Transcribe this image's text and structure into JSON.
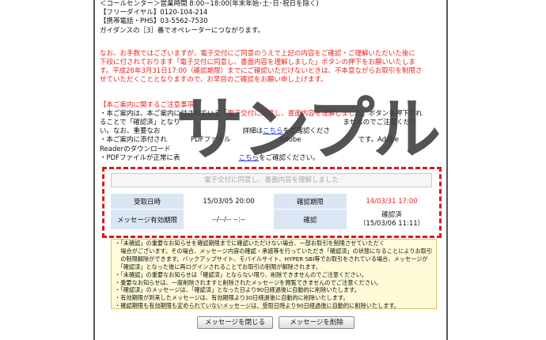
{
  "contact": {
    "line1": "＜コールセンター＞営業時間 8:00~18:00(年末年始･土･日･祝日を除く)",
    "line2": "【フリーダイヤル】0120-104-214",
    "line3": "【携帯電話・PHS】03-5562-7530",
    "line4": "ガイダンスの［3］番でオペレーターにつながります。"
  },
  "warning": {
    "line1": "なお、お手数ではございますが、電子交付にご同意のうえで上記の内容をご確認・ご理解いただいた後に",
    "line2": "下段に付されております「電子交付に同意し、書面内容を理解しました」ボタンの押下をお願いいたしま",
    "line3": "す。平成26年3月31日17:00（確認期限）までにご確認いただけないときは、不本意ながらお取引を制限さ",
    "line4": "せていただくこととなりますので、お早目のご確認をお願い申し上げます。"
  },
  "notes": {
    "heading": "【本ご案内に関するご注意事項】",
    "l1_a": "・本ご案内は、本ご案内に付されている「",
    "l1_hl": "電子交付に同意し、書面内容を理解しました",
    "l1_b": "」ボタンを押下され",
    "l2_a": "ることで「確認済」となり",
    "l2_b": "ませんのでご注意くださ",
    "l3_a": "い。なお、重要なお",
    "l3_b": "詳細は",
    "l3_link": "こちら",
    "l3_c": "をご確認くださ",
    "l4_a": "・本ご案内に添付され",
    "l4_b": "PDFファイル",
    "l4_c": "Adobe",
    "l4_d": "です。Adobe",
    "l5_a": "Readerのダウンロード",
    "l6_a": "・PDFファイルが正常に表",
    "l6_link": "こちら",
    "l6_b": "をご確認ください。"
  },
  "watermark": "サンプル",
  "agree_button": "電子交付に同意し、書面内容を理解しました",
  "info": {
    "received_label": "受取日時",
    "received_value": "15/03/05 20:00",
    "deadline_label": "確認期限",
    "deadline_value": "14/03/31 17:00",
    "expiry_label": "メッセージ有効期限",
    "expiry_value": "--/--/-- --:--",
    "confirm_label": "確認",
    "confirm_status": "確認済",
    "confirm_date": "（15/03/06 11:11）"
  },
  "notice_lines": [
    "・「未確認」の重要なお知らせを確認期限までに確認いただけない場合、一部お取引を制限させていただく",
    "　場合がございます。その場合、メッセージ内容の確認・承諾等を行っていただき「確認済」の状態になることによりお取引",
    "　の制限解除ができます。バックアップサイト、モバイルサイト、HYPER SBI等でお取引をされている場合、メッセージが",
    "　「確認済」となった後に再ログインされることでお取引の制限が解除されます。",
    "・「未確認」の重要なお知らせは「確認済」とならない限り、削除できませんのでご注意ください。",
    "・重要なお知らせは、一度削除されますと削除されたメッセージを閲覧できませんのでご注意ください。",
    "・「確認済」のメッセージは、「確認済」となった日より90日経過後に自動的に削除いたします。",
    "・有効期限が到来したメッセージは、有効期限より30日経過後に自動的に削除いたします。",
    "・確認期限も有効期限も定められていないメッセージは、受取日時より90日経過後に自動的に削除いたします。"
  ],
  "buttons": {
    "close": "メッセージを閉じる",
    "delete": "メッセージを削除"
  },
  "colors": {
    "alert_red": "#e8251f",
    "header_cell_blue": "#dbe6f4",
    "notice_yellow": "#fffbd9",
    "dash_red": "#e01818"
  }
}
